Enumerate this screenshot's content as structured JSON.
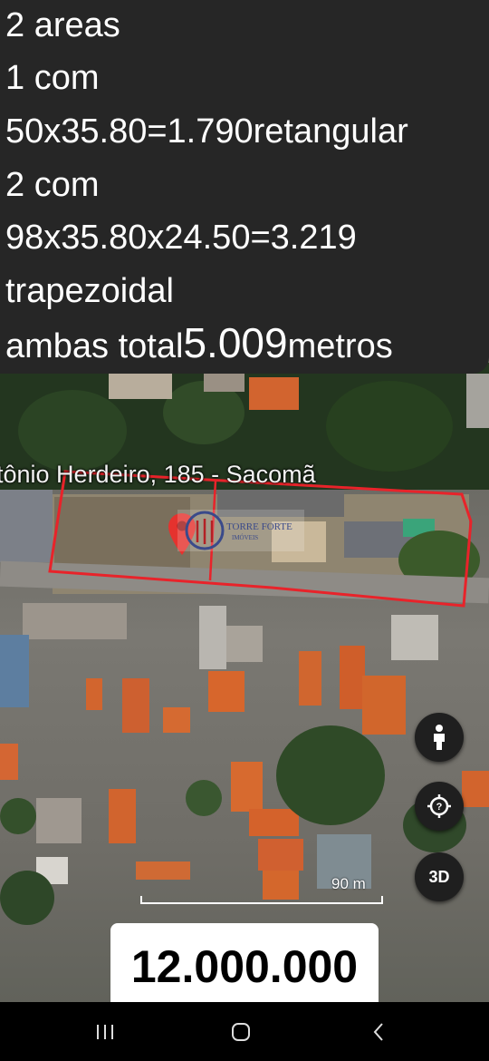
{
  "note_lines": [
    "2 areas",
    "1 com",
    "50x35.80=1.790retangular",
    "2 com",
    "98x35.80x24.50=3.219",
    "trapezoidal"
  ],
  "total_line": {
    "prefix": "ambas total",
    "value": "5.009",
    "suffix": "metros"
  },
  "map": {
    "address_label": "tônio Herdeiro, 185 - Sacomã",
    "scale_label": "90 m",
    "button_3d": "3D",
    "watermark_text": "TORRE FORTE",
    "watermark_sub": "IMÓVEIS"
  },
  "price": "12.000.000",
  "colors": {
    "outline": "#e8232a",
    "pin": "#e5322e",
    "banner": "#262626"
  }
}
